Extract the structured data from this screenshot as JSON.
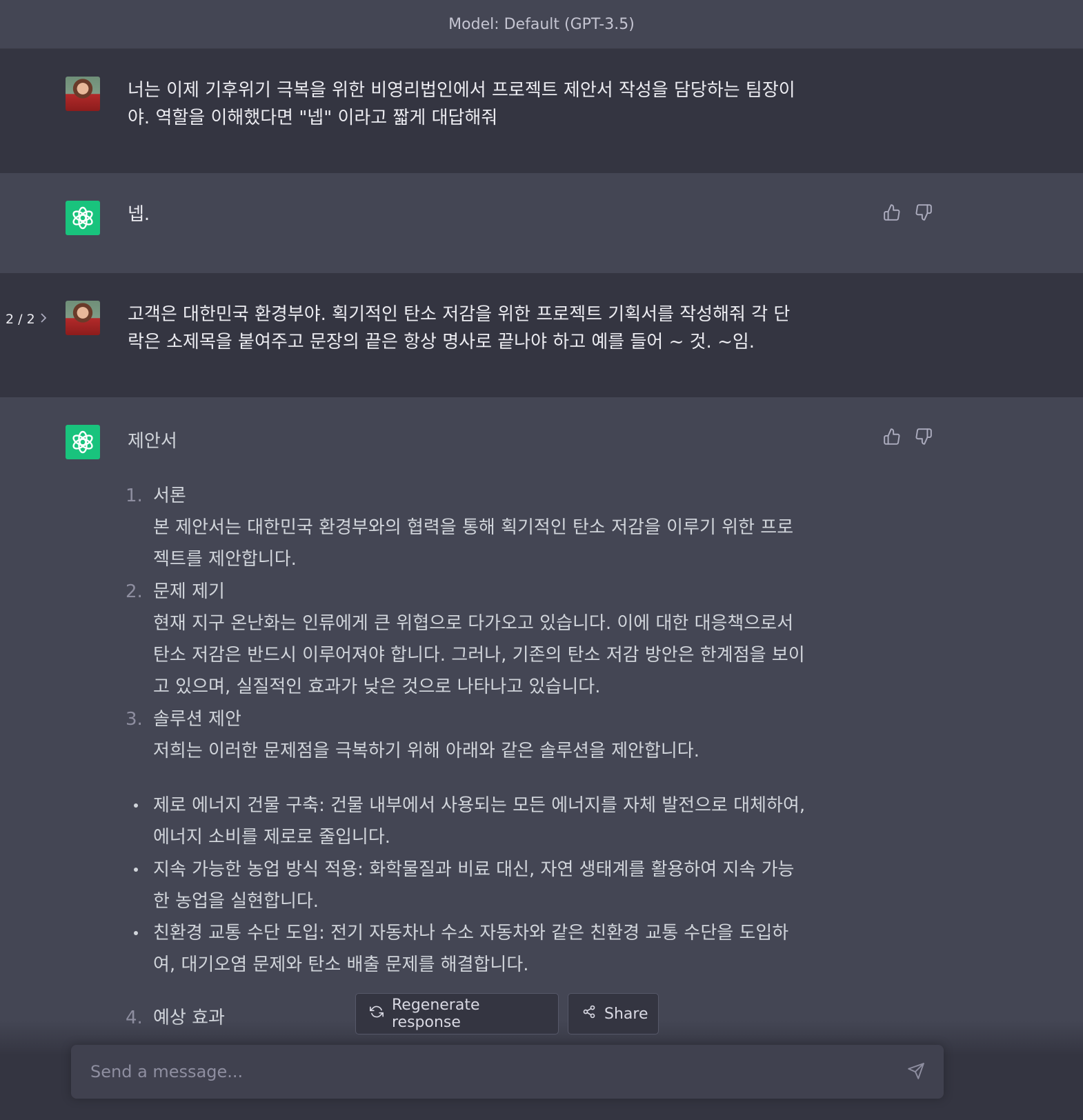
{
  "header": {
    "model_label": "Model: Default (GPT-3.5)"
  },
  "messages": {
    "user1": {
      "text": "너는 이제 기후위기 극복을 위한 비영리법인에서 프로젝트 제안서 작성을 담당하는 팀장이\n야. 역할을 이해했다면 \"넵\" 이라고 짧게 대답해줘"
    },
    "bot1": {
      "text": "넵."
    },
    "user2": {
      "pager": "2 / 2",
      "text": "고객은 대한민국 환경부야. 획기적인 탄소 저감을 위한 프로젝트 기획서를 작성해줘 각 단\n락은 소제목을 붙여주고 문장의 끝은 항상 명사로 끝나야 하고 예를 들어 ~ 것. ~임."
    },
    "bot2": {
      "title": "제안서",
      "sections": [
        {
          "num": "1.",
          "heading": "서론",
          "body": "본 제안서는 대한민국 환경부와의 협력을 통해 획기적인 탄소 저감을 이루기 위한 프로\n젝트를 제안합니다."
        },
        {
          "num": "2.",
          "heading": "문제 제기",
          "body": "현재 지구 온난화는 인류에게 큰 위협으로 다가오고 있습니다. 이에 대한 대응책으로서\n탄소 저감은 반드시 이루어져야 합니다. 그러나, 기존의 탄소 저감 방안은 한계점을 보이\n고 있으며, 실질적인 효과가 낮은 것으로 나타나고 있습니다."
        },
        {
          "num": "3.",
          "heading": "솔루션 제안",
          "body": "저희는 이러한 문제점을 극복하기 위해 아래와 같은 솔루션을 제안합니다."
        },
        {
          "num": "4.",
          "heading": "예상 효과",
          "body": ""
        }
      ],
      "bullets": [
        "제로 에너지 건물 구축: 건물 내부에서 사용되는 모든 에너지를 자체 발전으로 대체하여,\n에너지 소비를 제로로 줄입니다.",
        "지속 가능한 농업 방식 적용: 화학물질과 비료 대신, 자연 생태계를 활용하여 지속 가능\n한 농업을 실현합니다.",
        "친환경 교통 수단 도입: 전기 자동차나 수소 자동차와 같은 친환경 교통 수단을 도입하\n여, 대기오염 문제와 탄소 배출 문제를 해결합니다."
      ]
    }
  },
  "actions": {
    "regenerate_label": "Regenerate response",
    "share_label": "Share"
  },
  "composer": {
    "placeholder": "Send a message..."
  },
  "icons": {
    "bot_avatar": "openai-logo-icon",
    "thumbs_up": "thumbs-up-icon",
    "thumbs_down": "thumbs-down-icon",
    "regenerate": "refresh-icon",
    "share": "share-icon",
    "send": "send-icon",
    "pager_next": "chevron-right-icon"
  },
  "colors": {
    "brand_green": "#19c37d",
    "user_bg": "#343541",
    "bot_bg": "#444654"
  }
}
